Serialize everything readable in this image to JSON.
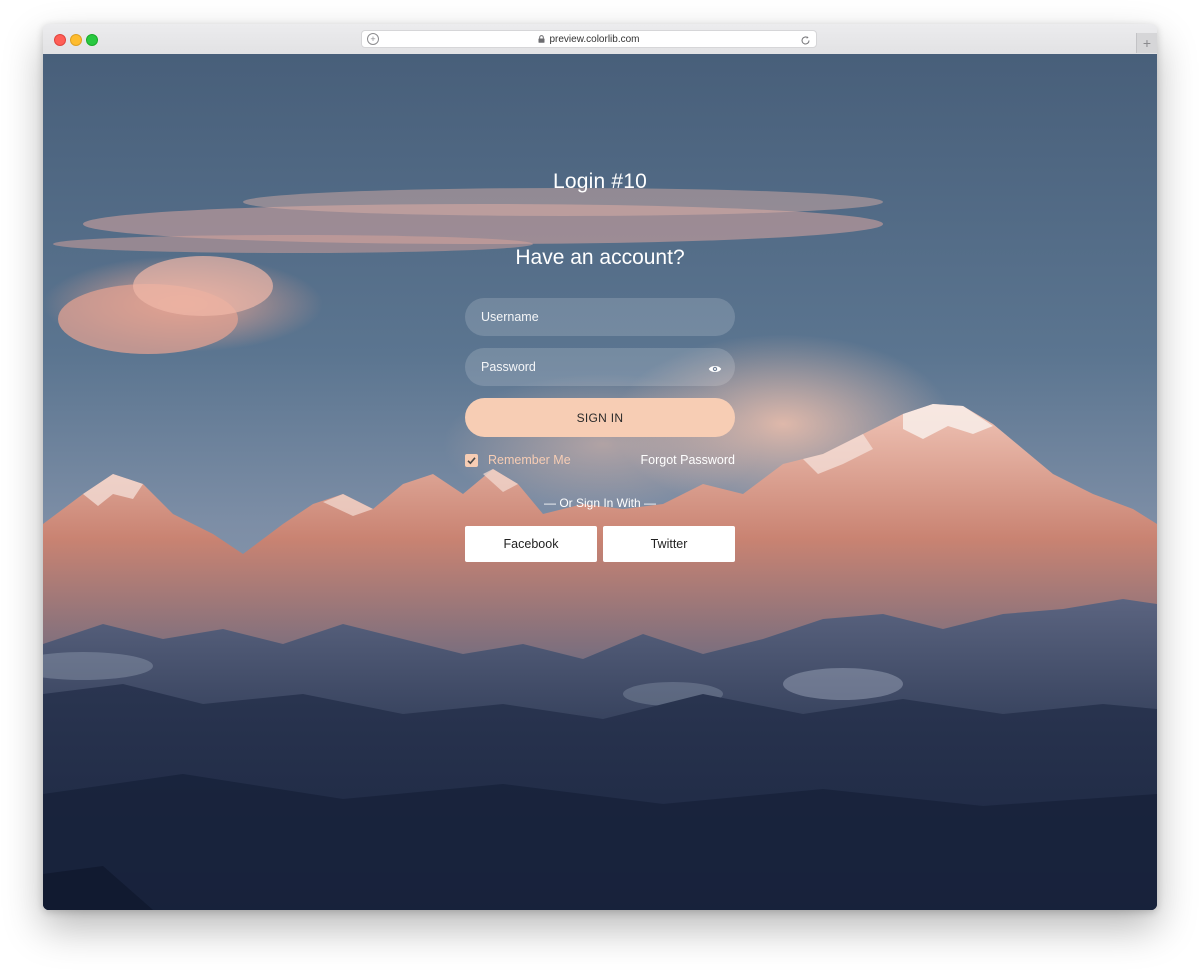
{
  "browser": {
    "url": "preview.colorlib.com",
    "new_tab_symbol": "+"
  },
  "login": {
    "title": "Login #10",
    "subtitle": "Have an account?",
    "username_placeholder": "Username",
    "password_placeholder": "Password",
    "sign_in_label": "SIGN IN",
    "remember_label": "Remember Me",
    "remember_checked": true,
    "forgot_label": "Forgot Password",
    "or_label": "— Or Sign In With —",
    "facebook_label": "Facebook",
    "twitter_label": "Twitter"
  },
  "colors": {
    "accent": "#f7cdb4",
    "sky": "#4f6580",
    "text": "#ffffff"
  },
  "icons": {
    "lock": "lock-icon",
    "reload": "reload-icon",
    "eye": "eye-icon",
    "check": "check-icon"
  }
}
